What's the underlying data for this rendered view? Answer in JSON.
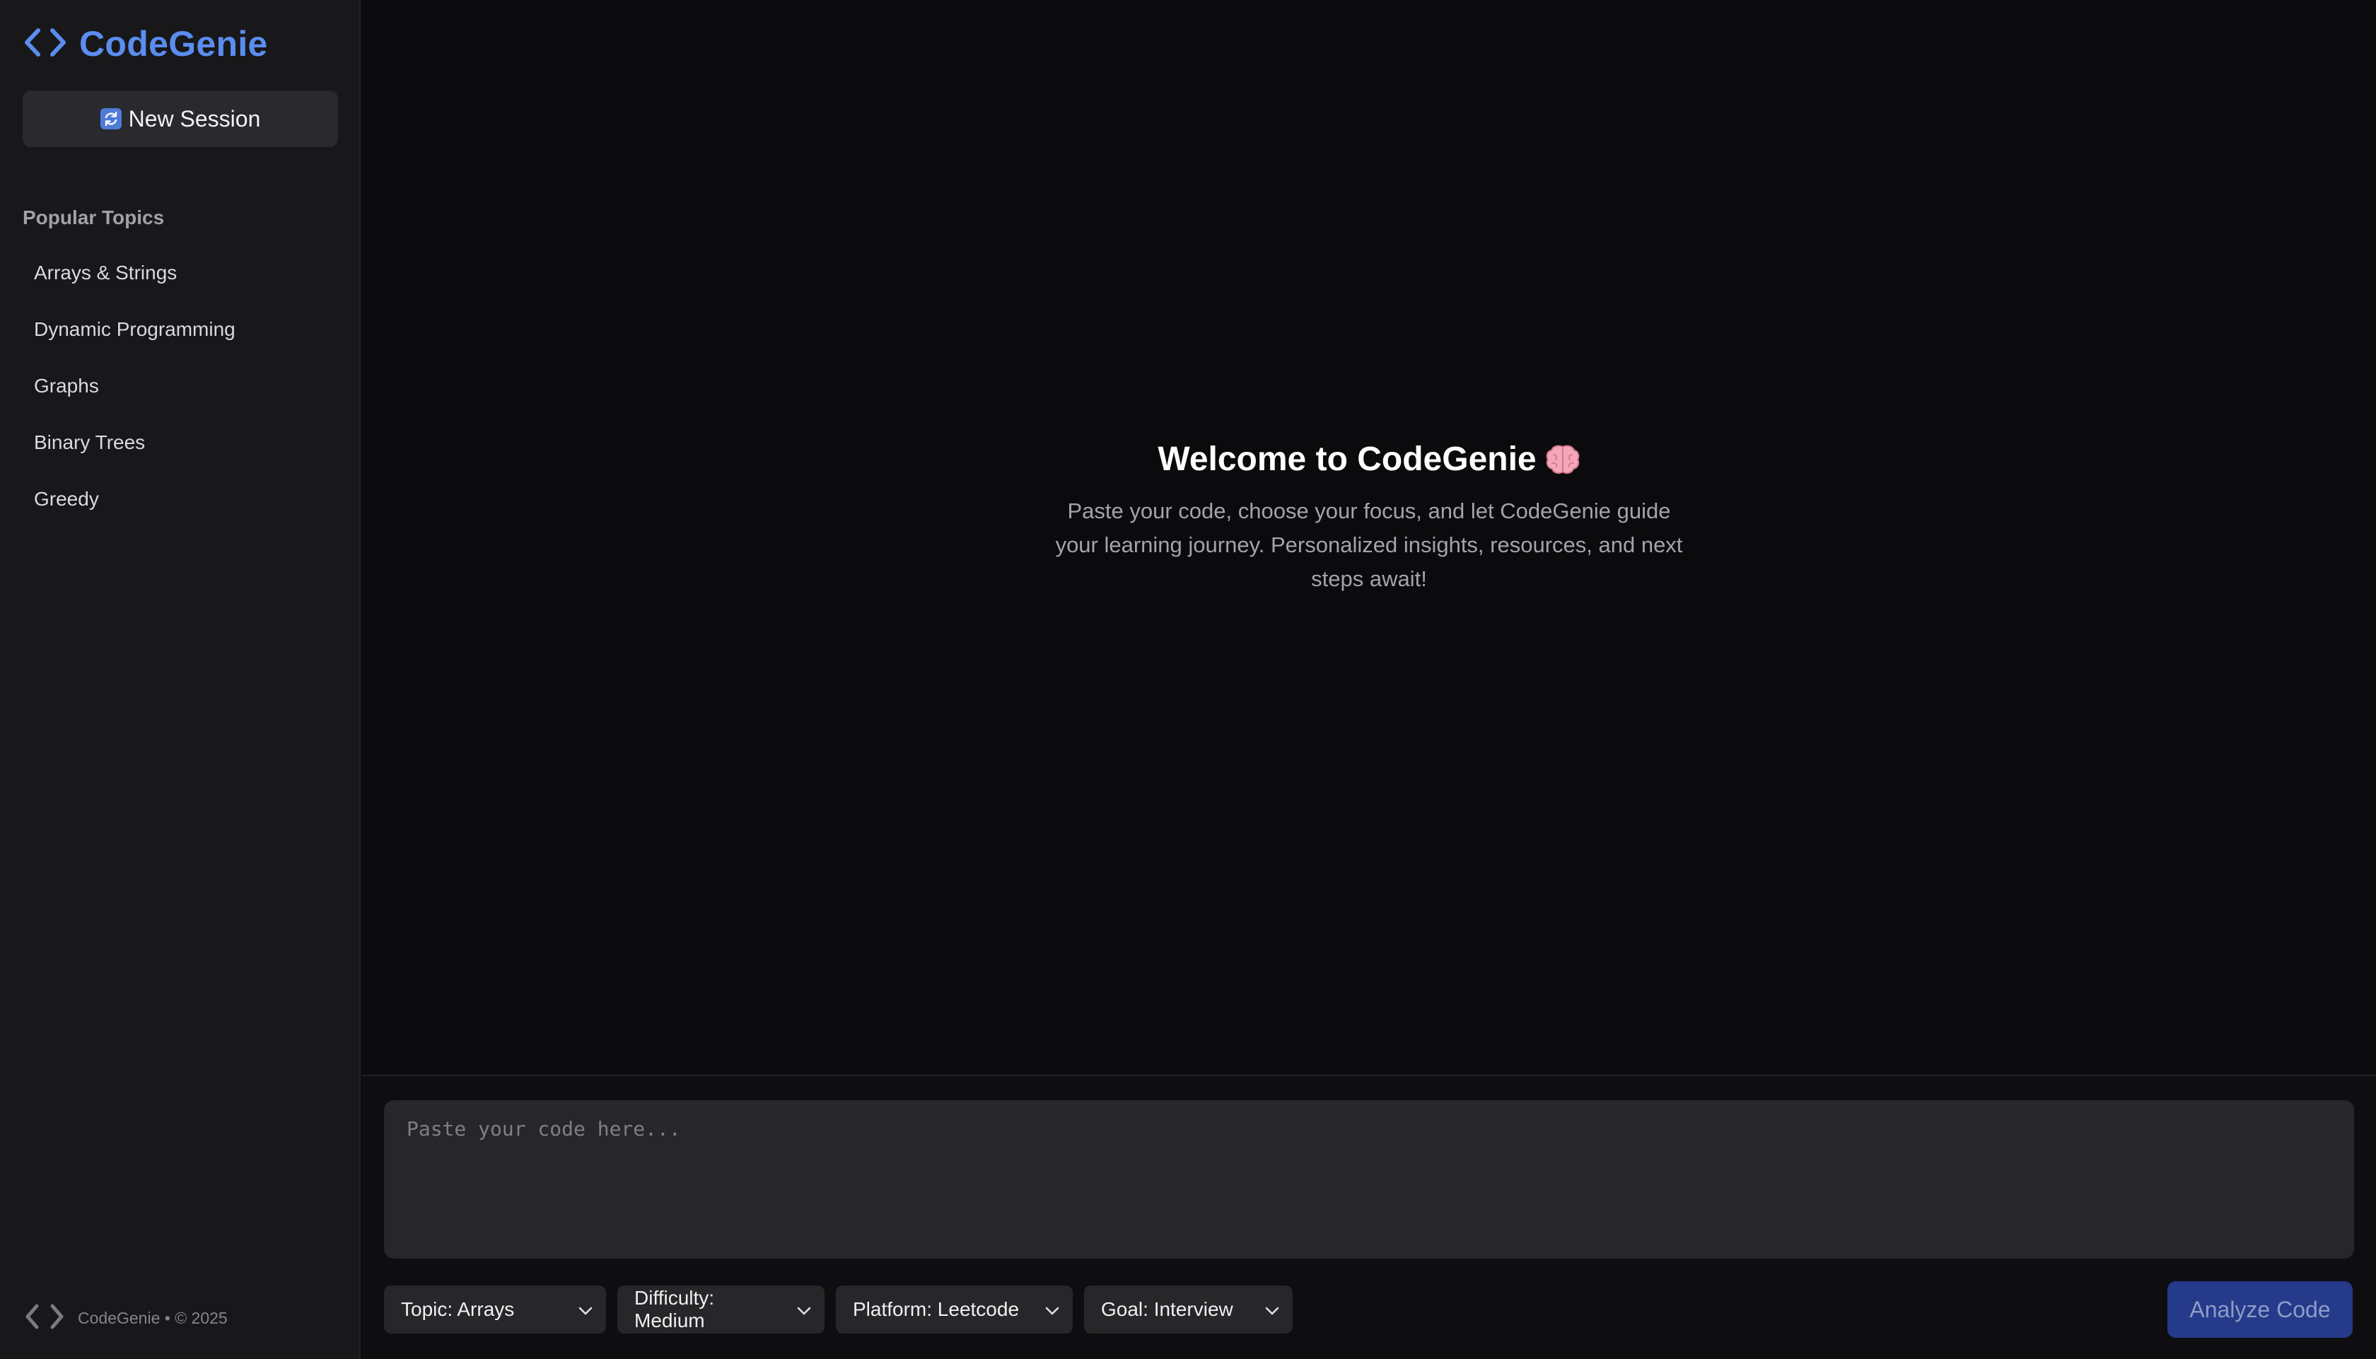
{
  "brand": {
    "name": "CodeGenie",
    "logo_icon": "code-brackets-icon",
    "color": "#5b8def"
  },
  "sidebar": {
    "new_session_label": "New Session",
    "new_session_icon": "refresh-icon",
    "section_title": "Popular Topics",
    "topics": [
      "Arrays & Strings",
      "Dynamic Programming",
      "Graphs",
      "Binary Trees",
      "Greedy"
    ],
    "footer_text": "CodeGenie • © 2025"
  },
  "main": {
    "welcome_title": "Welcome to CodeGenie",
    "welcome_icon": "brain-icon",
    "welcome_text": "Paste your code, choose your focus, and let CodeGenie guide your learning journey. Personalized insights, resources, and next steps await!"
  },
  "composer": {
    "placeholder": "Paste your code here...",
    "value": "",
    "selects": {
      "topic": "Topic: Arrays",
      "difficulty": "Difficulty: Medium",
      "platform": "Platform: Leetcode",
      "goal": "Goal: Interview"
    },
    "analyze_label": "Analyze Code",
    "analyze_color": "#253a8a"
  }
}
